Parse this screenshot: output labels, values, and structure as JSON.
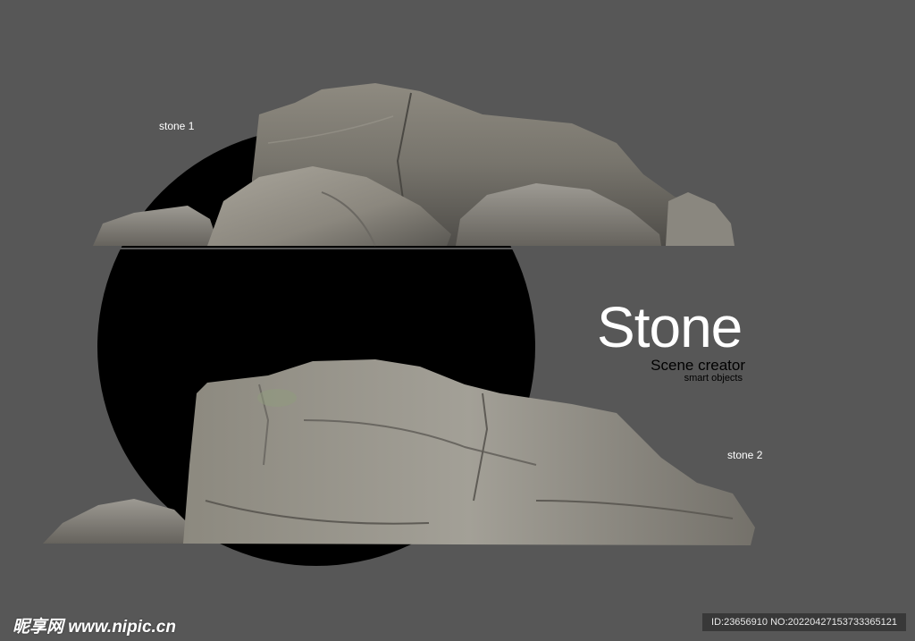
{
  "labels": {
    "stone1": "stone 1",
    "stone2": "stone 2"
  },
  "title": "Stone",
  "subtitle": "Scene creator",
  "subtitle_small": "smart objects",
  "watermark": {
    "site": "昵享网 www.nipic.cn",
    "id": "ID:23656910 NO:20220427153733365121"
  },
  "colors": {
    "background": "#575757",
    "circle": "#000000",
    "rock_light": "#a8a49a",
    "rock_dark": "#5e5c57"
  }
}
